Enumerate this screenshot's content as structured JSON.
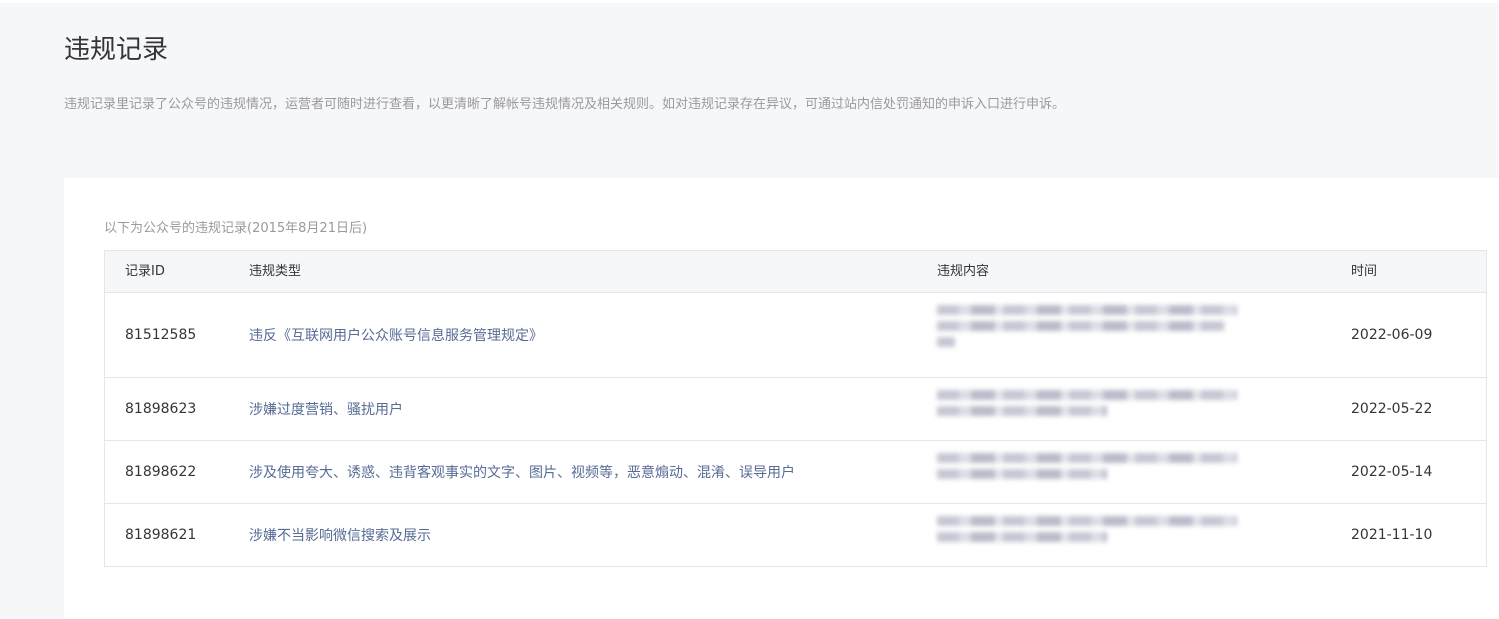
{
  "page": {
    "title": "违规记录",
    "description": "违规记录里记录了公众号的违规情况，运营者可随时进行查看，以更清晰了解帐号违规情况及相关规则。如对违规记录存在异议，可通过站内信处罚通知的申诉入口进行申诉。"
  },
  "table": {
    "caption": "以下为公众号的违规记录(2015年8月21日后)",
    "headers": {
      "id": "记录ID",
      "type": "违规类型",
      "content": "违规内容",
      "time": "时间"
    },
    "rows": [
      {
        "id": "81512585",
        "type": "违反《互联网用户公众账号信息服务管理规定》",
        "content_lines": 3,
        "time": "2022-06-09"
      },
      {
        "id": "81898623",
        "type": "涉嫌过度营销、骚扰用户",
        "content_lines": 2,
        "time": "2022-05-22"
      },
      {
        "id": "81898622",
        "type": "涉及使用夸大、诱惑、违背客观事实的文字、图片、视频等，恶意煽动、混淆、误导用户",
        "content_lines": 2,
        "time": "2022-05-14"
      },
      {
        "id": "81898621",
        "type": "涉嫌不当影响微信搜索及展示",
        "content_lines": 2,
        "time": "2021-11-10"
      }
    ]
  },
  "colors": {
    "link": "#576b95",
    "muted_text": "#9a9a9a",
    "header_bg": "#f6f7f9",
    "border": "#e4e6eb"
  }
}
